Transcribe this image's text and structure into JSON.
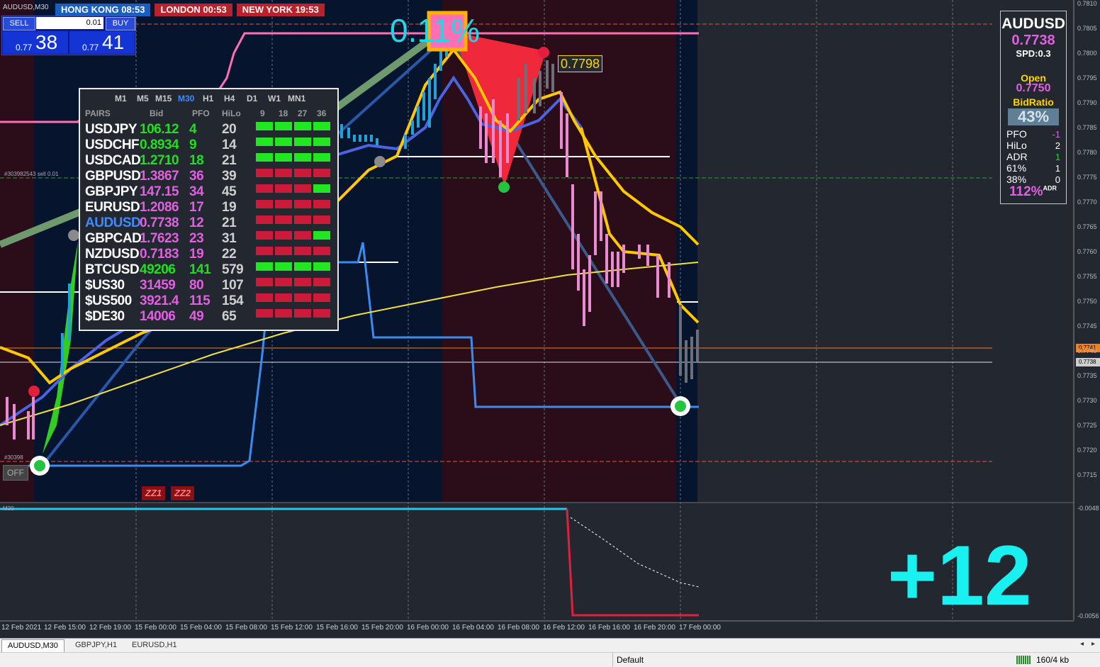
{
  "window": {
    "chart_title": "AUDUSD,M30"
  },
  "sessions": [
    {
      "label": "HONG KONG 08:53"
    },
    {
      "label": "LONDON  00:53"
    },
    {
      "label": "NEW YORK 19:53"
    }
  ],
  "trade_panel": {
    "sell_label": "SELL",
    "buy_label": "BUY",
    "lot": "0.01",
    "bid_small": "0.77",
    "bid_large": "38",
    "ask_small": "0.77",
    "ask_large": "41"
  },
  "pairs_table": {
    "timeframes": [
      "M1",
      "M5",
      "M15",
      "M30",
      "H1",
      "H4",
      "D1",
      "W1",
      "MN1"
    ],
    "active_timeframe": "M30",
    "headers": {
      "pairs": "PAIRS",
      "bid": "Bid",
      "pfo": "PFO",
      "hilo": "HiLo",
      "h9": "9",
      "h18": "18",
      "h27": "27",
      "h36": "36"
    },
    "rows": [
      {
        "sym": "USDJPY",
        "bid": "106.12",
        "pfo": "4",
        "hilo": "20",
        "dir": "up",
        "bars": [
          "g",
          "g",
          "g",
          "g"
        ]
      },
      {
        "sym": "USDCHF",
        "bid": "0.8934",
        "pfo": "9",
        "hilo": "14",
        "dir": "up",
        "bars": [
          "g",
          "g",
          "g",
          "g"
        ]
      },
      {
        "sym": "USDCAD",
        "bid": "1.2710",
        "pfo": "18",
        "hilo": "21",
        "dir": "up",
        "bars": [
          "g",
          "g",
          "g",
          "g"
        ]
      },
      {
        "sym": "GBPUSD",
        "bid": "1.3867",
        "pfo": "36",
        "hilo": "39",
        "dir": "down",
        "bars": [
          "r",
          "r",
          "r",
          "r"
        ]
      },
      {
        "sym": "GBPJPY",
        "bid": "147.15",
        "pfo": "34",
        "hilo": "45",
        "dir": "down",
        "bars": [
          "r",
          "r",
          "r",
          "g"
        ]
      },
      {
        "sym": "EURUSD",
        "bid": "1.2086",
        "pfo": "17",
        "hilo": "19",
        "dir": "down",
        "bars": [
          "r",
          "r",
          "r",
          "r"
        ]
      },
      {
        "sym": "AUDUSD",
        "bid": "0.7738",
        "pfo": "12",
        "hilo": "21",
        "dir": "down",
        "bars": [
          "r",
          "r",
          "r",
          "r"
        ],
        "highlight": true
      },
      {
        "sym": "GBPCAD",
        "bid": "1.7623",
        "pfo": "23",
        "hilo": "31",
        "dir": "down",
        "bars": [
          "r",
          "r",
          "r",
          "g"
        ]
      },
      {
        "sym": "NZDUSD",
        "bid": "0.7183",
        "pfo": "19",
        "hilo": "22",
        "dir": "down",
        "bars": [
          "r",
          "r",
          "r",
          "r"
        ]
      },
      {
        "sym": "BTCUSD",
        "bid": "49206",
        "pfo": "141",
        "hilo": "579",
        "dir": "up",
        "bars": [
          "g",
          "g",
          "g",
          "g"
        ]
      },
      {
        "sym": "$US30",
        "bid": "31459",
        "pfo": "80",
        "hilo": "107",
        "dir": "down",
        "bars": [
          "r",
          "r",
          "r",
          "r"
        ]
      },
      {
        "sym": "$US500",
        "bid": "3921.4",
        "pfo": "115",
        "hilo": "154",
        "dir": "down",
        "bars": [
          "r",
          "r",
          "r",
          "r"
        ]
      },
      {
        "sym": "$DE30",
        "bid": "14006",
        "pfo": "49",
        "hilo": "65",
        "dir": "down",
        "bars": [
          "r",
          "r",
          "r",
          "r"
        ]
      }
    ]
  },
  "info_panel": {
    "symbol": "AUDUSD",
    "price": "0.7738",
    "spread": "SPD:0.3",
    "open_label": "Open",
    "open_value": "0.7750",
    "bidratio_label": "BidRatio",
    "bidratio_value": "43%",
    "bidratio": 0.43,
    "stats": [
      {
        "label": "PFO",
        "value": "-1",
        "color": "#e060e0"
      },
      {
        "label": "HiLo",
        "value": "2",
        "color": "#ffffff"
      },
      {
        "label": "ADR",
        "value": "1",
        "color": "#22d422"
      },
      {
        "label": "61%",
        "value": "1",
        "color": "#ffffff"
      },
      {
        "label": "38%",
        "value": "0",
        "color": "#ffffff"
      }
    ],
    "adr_pct": "112%",
    "adr_sup": "ADR"
  },
  "overlays": {
    "pct_text": "0.11%",
    "price_label": "0.7798",
    "trade_note_1": "#303982543 sell 0.01",
    "trade_note_2": "#30398",
    "zz1": "ZZ1",
    "zz2": "ZZ2",
    "off_button": "OFF",
    "big_number": "+12",
    "subwindow_label": "M30"
  },
  "price_axis": [
    "0.7810",
    "0.7805",
    "0.7800",
    "0.7795",
    "0.7790",
    "0.7785",
    "0.7780",
    "0.7775",
    "0.7770",
    "0.7765",
    "0.7760",
    "0.7755",
    "0.7750",
    "0.7745",
    "0.7740",
    "0.7735",
    "0.7730",
    "0.7725",
    "0.7720",
    "0.7715"
  ],
  "axis_tags": {
    "orange": "0.7741",
    "white": "0.7738"
  },
  "sub_axis": {
    "top": "-0.0048",
    "bottom": "-0.0056"
  },
  "time_axis": [
    "12 Feb 2021",
    "12 Feb 15:00",
    "12 Feb 19:00",
    "15 Feb 00:00",
    "15 Feb 04:00",
    "15 Feb 08:00",
    "15 Feb 12:00",
    "15 Feb 16:00",
    "15 Feb 20:00",
    "16 Feb 00:00",
    "16 Feb 04:00",
    "16 Feb 08:00",
    "16 Feb 12:00",
    "16 Feb 16:00",
    "16 Feb 20:00",
    "17 Feb 00:00"
  ],
  "tabs": [
    "AUDUSD,M30",
    "GBPJPY,H1",
    "EURUSD,H1"
  ],
  "status": {
    "profile": "Default",
    "traffic": "160/4 kb"
  },
  "colors": {
    "up": "#22dd22",
    "down": "#dd1f45",
    "pink": "#ff6fb3",
    "yellow": "#ffd400",
    "blue": "#3f6fe8",
    "accent": "#1a5fbf"
  }
}
